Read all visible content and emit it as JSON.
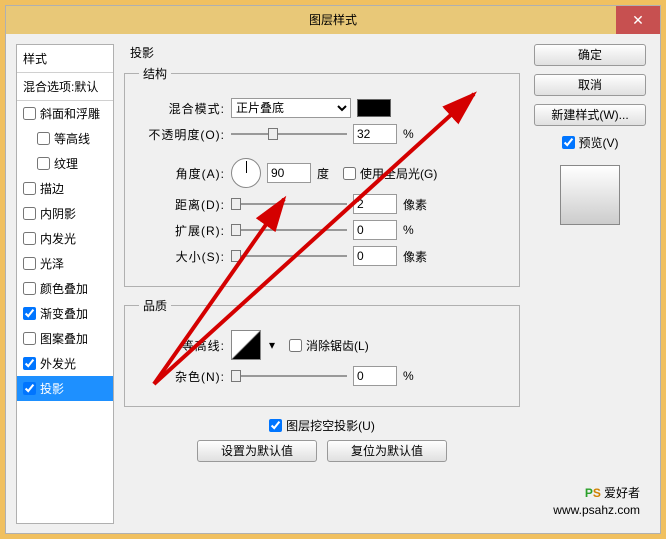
{
  "title": "图层样式",
  "sidebar": {
    "header": "样式",
    "blendDefault": "混合选项:默认",
    "items": [
      {
        "label": "斜面和浮雕",
        "checked": false,
        "indent": 0
      },
      {
        "label": "等高线",
        "checked": false,
        "indent": 1
      },
      {
        "label": "纹理",
        "checked": false,
        "indent": 1
      },
      {
        "label": "描边",
        "checked": false,
        "indent": 0
      },
      {
        "label": "内阴影",
        "checked": false,
        "indent": 0
      },
      {
        "label": "内发光",
        "checked": false,
        "indent": 0
      },
      {
        "label": "光泽",
        "checked": false,
        "indent": 0
      },
      {
        "label": "颜色叠加",
        "checked": false,
        "indent": 0
      },
      {
        "label": "渐变叠加",
        "checked": true,
        "indent": 0
      },
      {
        "label": "图案叠加",
        "checked": false,
        "indent": 0
      },
      {
        "label": "外发光",
        "checked": true,
        "indent": 0
      },
      {
        "label": "投影",
        "checked": true,
        "indent": 0,
        "selected": true
      }
    ]
  },
  "panel": {
    "title": "投影",
    "structure": "结构",
    "blendMode": {
      "label": "混合模式:",
      "value": "正片叠底",
      "color": "#000000"
    },
    "opacity": {
      "label": "不透明度(O):",
      "value": "32",
      "unit": "%",
      "pos": 32
    },
    "angle": {
      "label": "角度(A):",
      "value": "90",
      "unit": "度"
    },
    "globalLight": {
      "label": "使用全局光(G)",
      "checked": false
    },
    "distance": {
      "label": "距离(D):",
      "value": "2",
      "unit": "像素",
      "pos": 0
    },
    "spread": {
      "label": "扩展(R):",
      "value": "0",
      "unit": "%",
      "pos": 0
    },
    "size": {
      "label": "大小(S):",
      "value": "0",
      "unit": "像素",
      "pos": 0
    },
    "quality": "品质",
    "contour": {
      "label": "等高线:"
    },
    "antialias": {
      "label": "消除锯齿(L)",
      "checked": false
    },
    "noise": {
      "label": "杂色(N):",
      "value": "0",
      "unit": "%",
      "pos": 0
    },
    "knockout": {
      "label": "图层挖空投影(U)",
      "checked": true
    },
    "setDefault": "设置为默认值",
    "resetDefault": "复位为默认值"
  },
  "right": {
    "ok": "确定",
    "cancel": "取消",
    "newStyle": "新建样式(W)...",
    "preview": {
      "label": "预览(V)",
      "checked": true
    }
  },
  "watermark": {
    "brand1": "P",
    "brand2": "S",
    "text": "爱好者",
    "url": "www.psahz.com"
  }
}
